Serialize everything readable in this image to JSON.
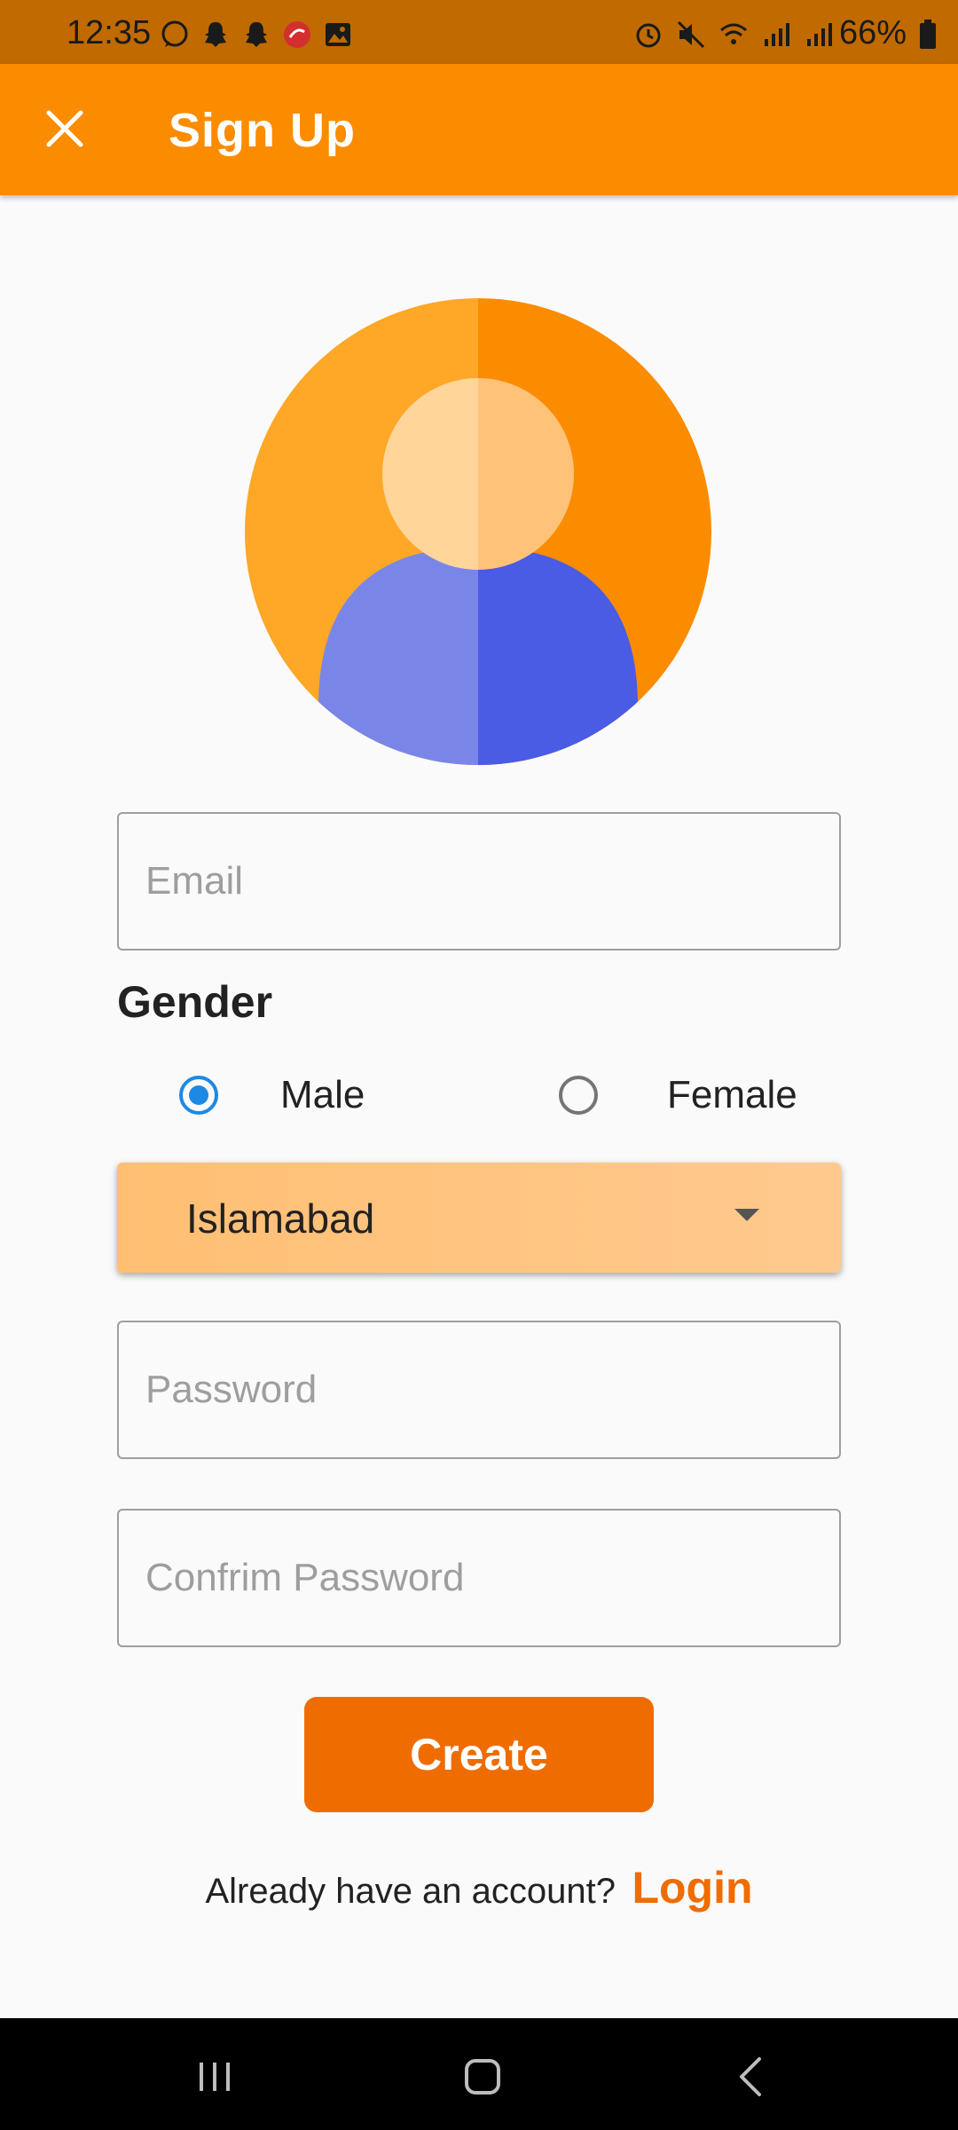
{
  "status_bar": {
    "time": "12:35",
    "battery": "66%",
    "left_icons": [
      "whatsapp-icon",
      "snapchat-icon",
      "snapchat-icon",
      "app-icon",
      "gallery-icon"
    ],
    "right_icons": [
      "alarm-icon",
      "mute-icon",
      "wifi-icon",
      "signal-icon",
      "signal-icon"
    ]
  },
  "app_bar": {
    "title": "Sign Up",
    "close_icon": "close-icon",
    "color": "#fb8c00"
  },
  "form": {
    "email_placeholder": "Email",
    "gender_label": "Gender",
    "gender_options": [
      "Male",
      "Female"
    ],
    "gender_selected": "Male",
    "city": "Islamabad",
    "password_placeholder": "Password",
    "confirm_password_placeholder": "Confrim Password",
    "create_label": "Create"
  },
  "footer": {
    "prompt": "Already have an account?",
    "login_label": "Login"
  },
  "colors": {
    "accent": "#ef6c00",
    "radio_selected": "#1e88e5"
  },
  "nav": {
    "icons": [
      "recents-icon",
      "home-icon",
      "back-icon"
    ]
  }
}
